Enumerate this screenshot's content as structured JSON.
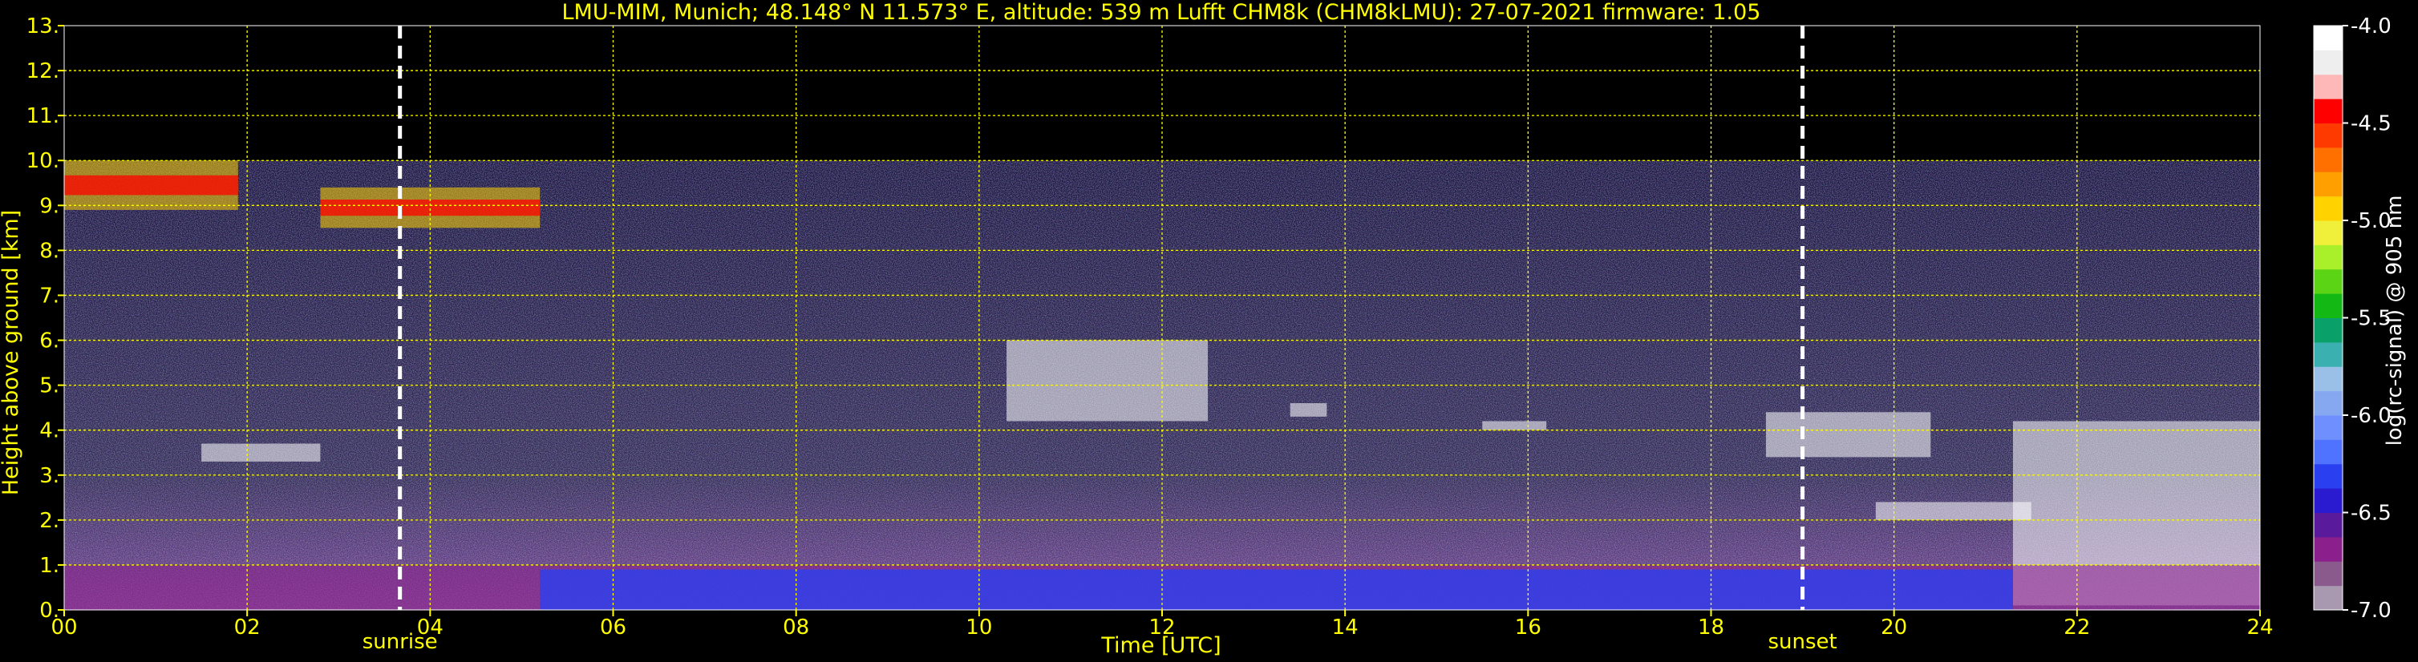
{
  "chart_data": {
    "type": "heatmap",
    "title": "LMU-MIM, Munich; 48.148° N 11.573° E, altitude: 539 m    Lufft CHM8k (CHM8kLMU): 27-07-2021    firmware: 1.05",
    "xlabel": "Time [UTC]",
    "ylabel": "Height above ground [km]",
    "xlim": [
      0,
      24
    ],
    "ylim": [
      0,
      13
    ],
    "x_ticks": [
      "00",
      "02",
      "04",
      "06",
      "08",
      "10",
      "12",
      "14",
      "16",
      "18",
      "20",
      "22",
      "24"
    ],
    "y_ticks": [
      "0.",
      "1.",
      "2.",
      "3.",
      "4.",
      "5.",
      "6.",
      "7.",
      "8.",
      "9.",
      "10.",
      "11.",
      "12.",
      "13."
    ],
    "grid": true,
    "grid_color": "#ffff00",
    "measurement_top_km": 10,
    "markers": [
      {
        "label": "sunrise",
        "x": 3.67
      },
      {
        "label": "sunset",
        "x": 19.0
      }
    ],
    "colorbar": {
      "label": "log(rc-signal) @ 905 nm",
      "range": [
        -7.0,
        -4.0
      ],
      "ticks": [
        "-4.0",
        "-4.5",
        "-5.0",
        "-5.5",
        "-6.0",
        "-6.5",
        "-7.0"
      ],
      "colors": [
        "#a899b0",
        "#8a5a8c",
        "#8b1f8c",
        "#5a1a9c",
        "#2a1ad0",
        "#2a40f0",
        "#4f73ff",
        "#6f8fff",
        "#86a8f0",
        "#9ac0e8",
        "#3ab0b0",
        "#0aa06a",
        "#14b814",
        "#5ad414",
        "#aaf02a",
        "#f0f03a",
        "#ffd200",
        "#ffa000",
        "#ff7000",
        "#ff3a00",
        "#ff0000",
        "#ffb8b8",
        "#eeeeee",
        "#ffffff"
      ]
    },
    "features": [
      {
        "name": "cirrus",
        "x_range": [
          0.0,
          1.9
        ],
        "height_km": [
          8.9,
          10.0
        ]
      },
      {
        "name": "cirrus",
        "x_range": [
          2.8,
          5.2
        ],
        "height_km": [
          8.5,
          9.4
        ]
      },
      {
        "name": "cloud",
        "x_range": [
          1.5,
          2.8
        ],
        "height_km": [
          3.3,
          3.7
        ]
      },
      {
        "name": "cloud",
        "x_range": [
          10.3,
          12.5
        ],
        "height_km": [
          4.2,
          6.0
        ]
      },
      {
        "name": "cloud",
        "x_range": [
          13.4,
          13.8
        ],
        "height_km": [
          4.3,
          4.6
        ]
      },
      {
        "name": "cloud",
        "x_range": [
          15.5,
          16.2
        ],
        "height_km": [
          4.0,
          4.2
        ]
      },
      {
        "name": "cloud",
        "x_range": [
          18.6,
          20.4
        ],
        "height_km": [
          3.4,
          4.4
        ]
      },
      {
        "name": "cloud",
        "x_range": [
          19.8,
          21.5
        ],
        "height_km": [
          2.0,
          2.4
        ]
      },
      {
        "name": "cloud",
        "x_range": [
          21.3,
          24.0
        ],
        "height_km": [
          0.1,
          4.2
        ]
      },
      {
        "name": "boundary_layer",
        "x_range": [
          0.0,
          24.0
        ],
        "height_km": [
          0.0,
          1.0
        ]
      }
    ]
  }
}
